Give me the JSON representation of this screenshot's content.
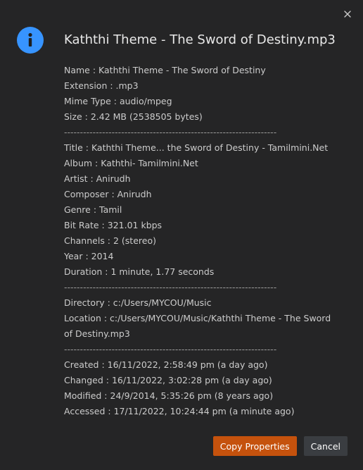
{
  "dialog": {
    "title": "Kaththi Theme - The Sword of Destiny.mp3",
    "icon": "info-icon",
    "close_icon": "close-icon",
    "accent_color": "#3794ff"
  },
  "details": {
    "lines": [
      "Name : Kaththi Theme - The Sword of Destiny",
      "Extension : .mp3",
      "Mime Type : audio/mpeg",
      "Size : 2.42 MB (2538505 bytes)",
      "-------------------------------------------------------------------",
      "Title : Kaththi Theme... the Sword of Destiny - Tamilmini.Net",
      "Album : Kaththi- Tamilmini.Net",
      "Artist : Anirudh",
      "Composer : Anirudh",
      "Genre : Tamil",
      "Bit Rate : 321.01 kbps",
      "Channels : 2 (stereo)",
      "Year : 2014",
      "Duration : 1 minute, 1.77 seconds",
      "-------------------------------------------------------------------",
      "Directory : c:/Users/MYCOU/Music",
      "Location : c:/Users/MYCOU/Music/Kaththi Theme - The Sword of Destiny.mp3",
      "-------------------------------------------------------------------",
      "Created : 16/11/2022, 2:58:49 pm (a day ago)",
      "Changed : 16/11/2022, 3:02:28 pm (a day ago)",
      "Modified : 24/9/2014, 5:35:26 pm (8 years ago)",
      "Accessed : 17/11/2022, 10:24:44 pm (a minute ago)"
    ]
  },
  "buttons": {
    "copy_label": "Copy Properties",
    "cancel_label": "Cancel",
    "copy_color": "#c5520d"
  }
}
